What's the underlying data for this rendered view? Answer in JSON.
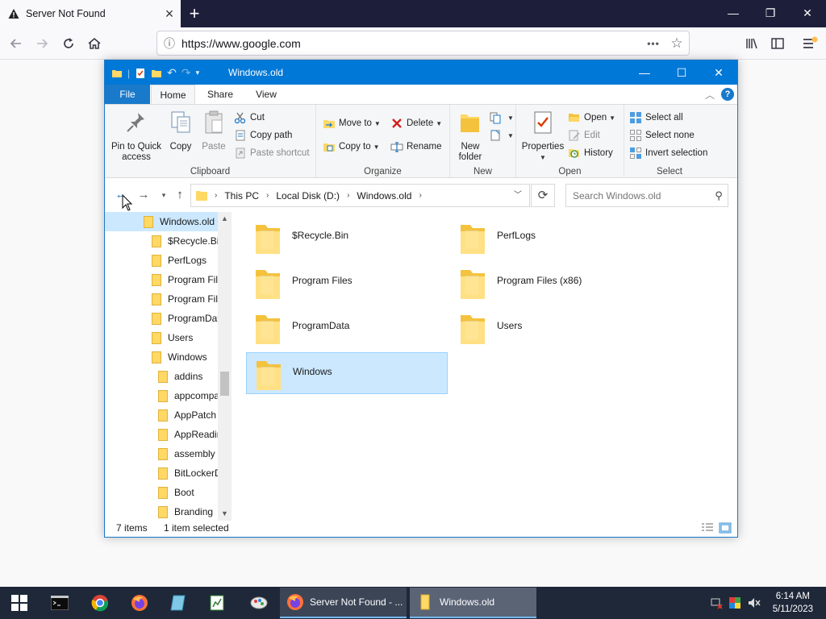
{
  "browser": {
    "tab_title": "Server Not Found",
    "url": "https://www.google.com",
    "new_tab_symbol": "+",
    "window_controls": {
      "minimize": "—",
      "restore": "❐",
      "close": "✕"
    }
  },
  "explorer": {
    "title": "Windows.old",
    "ribbon_tabs": [
      "File",
      "Home",
      "Share",
      "View"
    ],
    "help_label": "?",
    "clipboard": {
      "pin_label_1": "Pin to Quick",
      "pin_label_2": "access",
      "copy": "Copy",
      "paste": "Paste",
      "cut": "Cut",
      "copy_path": "Copy path",
      "paste_shortcut": "Paste shortcut",
      "group": "Clipboard"
    },
    "organize": {
      "move_to": "Move to",
      "copy_to": "Copy to",
      "delete": "Delete",
      "rename": "Rename",
      "group": "Organize"
    },
    "new": {
      "new_folder_1": "New",
      "new_folder_2": "folder",
      "group": "New"
    },
    "open": {
      "properties": "Properties",
      "open": "Open",
      "edit": "Edit",
      "history": "History",
      "group": "Open"
    },
    "select": {
      "select_all": "Select all",
      "select_none": "Select none",
      "invert": "Invert selection",
      "group": "Select"
    },
    "breadcrumb": [
      "This PC",
      "Local Disk (D:)",
      "Windows.old"
    ],
    "search_placeholder": "Search Windows.old",
    "nav_tree": [
      {
        "label": "Windows.old",
        "level": 0,
        "selected": true
      },
      {
        "label": "$Recycle.Bin",
        "level": 1
      },
      {
        "label": "PerfLogs",
        "level": 1
      },
      {
        "label": "Program Fil",
        "level": 1
      },
      {
        "label": "Program Fil",
        "level": 1
      },
      {
        "label": "ProgramDat",
        "level": 1
      },
      {
        "label": "Users",
        "level": 1
      },
      {
        "label": "Windows",
        "level": 1
      },
      {
        "label": "addins",
        "level": 2
      },
      {
        "label": "appcompa",
        "level": 2
      },
      {
        "label": "AppPatch",
        "level": 2
      },
      {
        "label": "AppReadin",
        "level": 2
      },
      {
        "label": "assembly",
        "level": 2
      },
      {
        "label": "BitLockerD",
        "level": 2
      },
      {
        "label": "Boot",
        "level": 2
      },
      {
        "label": "Branding",
        "level": 2
      }
    ],
    "items": [
      {
        "name": "$Recycle.Bin"
      },
      {
        "name": "PerfLogs"
      },
      {
        "name": "Program Files"
      },
      {
        "name": "Program Files (x86)"
      },
      {
        "name": "ProgramData"
      },
      {
        "name": "Users"
      },
      {
        "name": "Windows",
        "selected": true
      }
    ],
    "status_count": "7 items",
    "status_selected": "1 item selected"
  },
  "taskbar": {
    "apps": [
      {
        "label": "Server Not Found - ..."
      },
      {
        "label": "Windows.old"
      }
    ],
    "time": "6:14 AM",
    "date": "5/11/2023"
  },
  "colors": {
    "accent": "#0078d7",
    "selection": "#cce8ff",
    "folder": "#ffd865",
    "taskbar": "#1e2838"
  }
}
